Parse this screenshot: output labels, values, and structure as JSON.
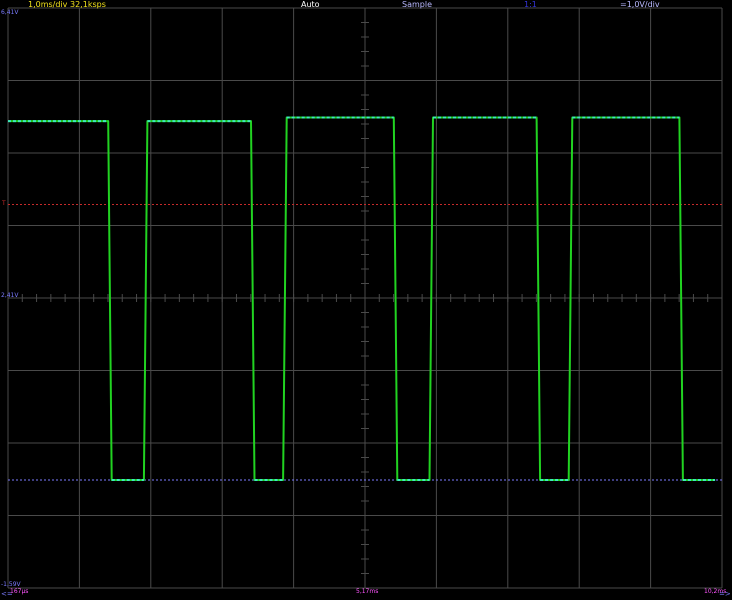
{
  "status_bar": {
    "timebase": "1,0ms/div",
    "sample_rate": "32,1ksps",
    "trigger_mode": "Auto",
    "acquisition_mode": "Sample",
    "probe_ratio": "1:1",
    "volts_per_div": "=1,0V/div"
  },
  "volt_labels": {
    "top": "6,41V",
    "middle": "2,41V",
    "bottom": "-1,59V",
    "trigger_marker": "T"
  },
  "time_labels": {
    "start": "167µs",
    "center": "5,17ms",
    "end": "10,2ms"
  },
  "bottom_arrows": {
    "left": "<=",
    "right": "=>"
  },
  "colors": {
    "background": "#000000",
    "grid": "#4a4a4a",
    "trace": "#21d321",
    "trace_highlight": "#3ee6c0",
    "trigger_line": "#c62a2a",
    "ground_marker": "#7b7bff",
    "status_yellow": "#f2e21b",
    "status_white": "#ffffff",
    "status_blue_light": "#b9b9ff",
    "status_blue": "#3434d8",
    "label_blue": "#7b7bff",
    "label_magenta": "#ff55ff"
  },
  "chart_data": {
    "type": "line",
    "title": "",
    "xlabel": "",
    "ylabel": "",
    "x_unit": "ms",
    "y_unit": "V",
    "xlim": [
      0.167,
      10.167
    ],
    "ylim": [
      -1.59,
      6.41
    ],
    "trigger_level_v": 3.7,
    "ground_level_v": -0.1,
    "series": [
      {
        "x": [
          0.167,
          1.57,
          1.62,
          2.07,
          2.12,
          3.57,
          3.62,
          4.02,
          4.07,
          5.57,
          5.62,
          6.07,
          6.12,
          7.57,
          7.62,
          8.02,
          8.07,
          9.57,
          9.62,
          10.07
        ],
        "y": [
          4.85,
          4.85,
          -0.1,
          -0.1,
          4.85,
          4.85,
          -0.1,
          -0.1,
          4.9,
          4.9,
          -0.1,
          -0.1,
          4.9,
          4.9,
          -0.1,
          -0.1,
          4.9,
          4.9,
          -0.1,
          -0.1
        ]
      }
    ]
  }
}
